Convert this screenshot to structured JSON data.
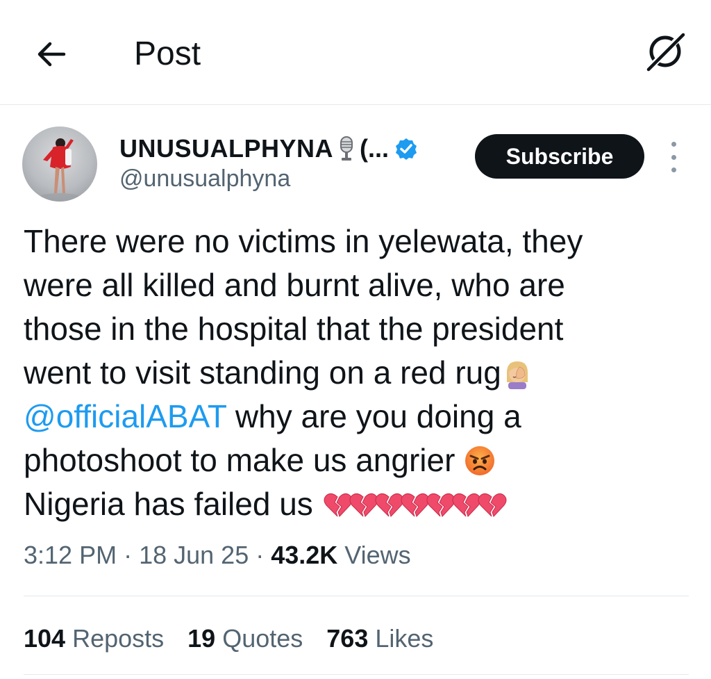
{
  "header": {
    "title": "Post",
    "back_icon": "arrow-left-icon",
    "grok_icon": "grok-icon"
  },
  "author": {
    "display_name": "UNUSUALPHYNA",
    "name_suffix": "(...",
    "mic_icon": "microphone-icon",
    "verified_icon": "verified-badge-icon",
    "handle": "@unusualphyna",
    "subscribe_label": "Subscribe"
  },
  "tweet": {
    "line1": "There were no victims in yelewata, they",
    "line2": "were all killed and burnt alive, who are",
    "line3": "those in the hospital that the president",
    "line4": "went to visit standing on a red rug",
    "mention": "@officialABAT",
    "line5_rest": " why are you doing a",
    "line6": "photoshoot to make us angrier",
    "line7": "Nigeria has failed us",
    "emoji_facepalm": "woman-facepalming-emoji",
    "emoji_angry": "angry-face-emoji",
    "emoji_broken_heart": "broken-heart-emoji",
    "broken_heart_count": 7
  },
  "meta": {
    "time": "3:12 PM",
    "sep1": " · ",
    "date": "18 Jun 25",
    "sep2": " · ",
    "views_count": "43.2K",
    "views_label": " Views"
  },
  "stats": {
    "reposts_count": "104",
    "reposts_label": " Reposts",
    "quotes_count": "19",
    "quotes_label": " Quotes",
    "likes_count": "763",
    "likes_label": " Likes"
  },
  "colors": {
    "link": "#1d9bf0",
    "text": "#0f1419",
    "muted": "#536471",
    "button_bg": "#0f1419"
  }
}
